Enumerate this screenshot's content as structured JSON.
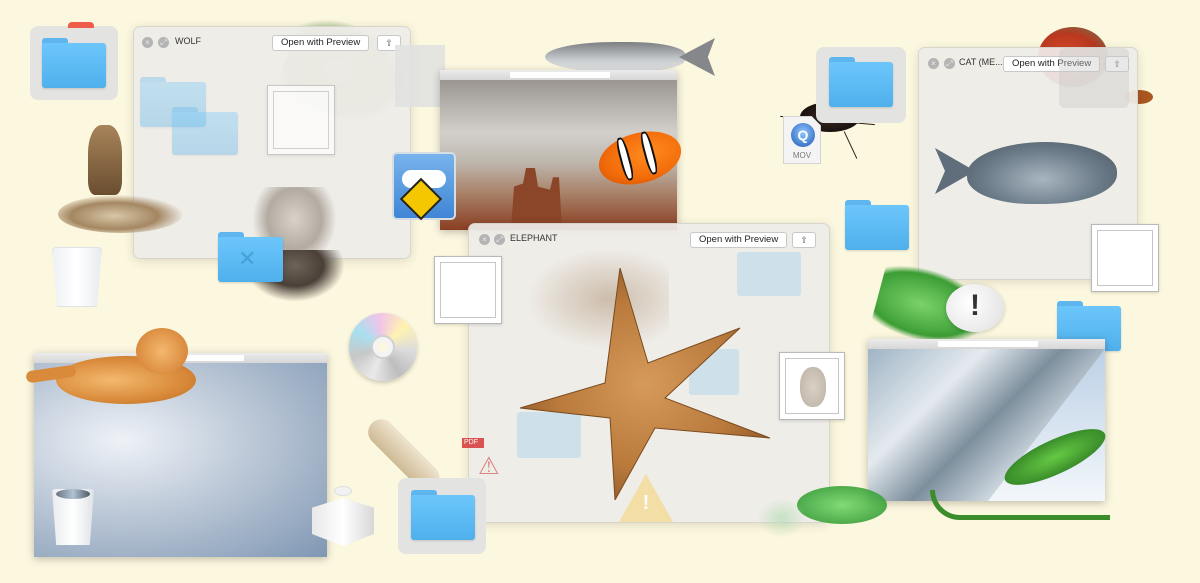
{
  "desktop": {
    "background_color": "#fcf7df"
  },
  "quicklook_windows": [
    {
      "title": "WOLF",
      "open_button": "Open with Preview",
      "share_icon": "share-icon",
      "close_icon": "close-icon",
      "fullscreen_icon": "fullscreen-icon"
    },
    {
      "title": "CAT (ME...",
      "open_button": "Open with Preview",
      "share_icon": "share-icon",
      "close_icon": "close-icon",
      "fullscreen_icon": "fullscreen-icon"
    },
    {
      "title": "ELEPHANT",
      "open_button": "Open with Preview",
      "share_icon": "share-icon",
      "close_icon": "close-icon",
      "fullscreen_icon": "fullscreen-icon"
    }
  ],
  "icons": {
    "mov_label": "MOV",
    "pdf_label": "PDF",
    "alert_glyph": "!",
    "warning_glyph": "!"
  },
  "colors": {
    "folder_blue": "#5fb6ef",
    "panel_gray": "#eeece8",
    "traffic_red": "#f25f58",
    "traffic_yellow": "#fbbe2e",
    "traffic_green": "#38c945"
  }
}
